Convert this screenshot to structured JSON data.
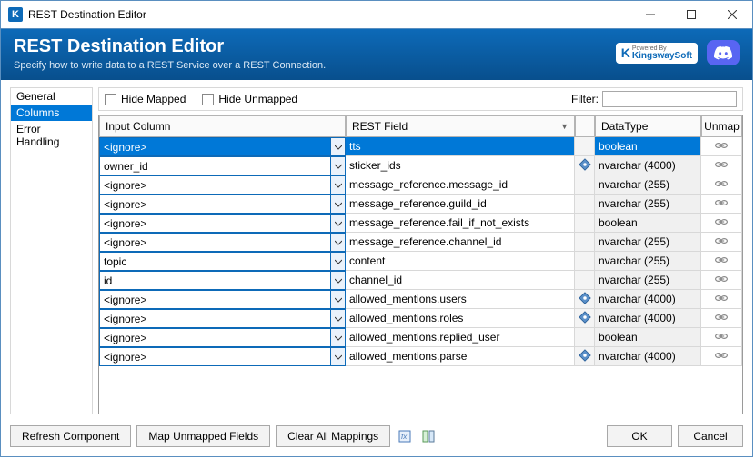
{
  "window": {
    "title": "REST Destination Editor"
  },
  "header": {
    "title": "REST Destination Editor",
    "subtitle": "Specify how to write data to a REST Service over a REST Connection.",
    "powered_prefix": "Powered By",
    "brand": "KingswaySoft"
  },
  "nav": {
    "items": [
      {
        "label": "General",
        "selected": false
      },
      {
        "label": "Columns",
        "selected": true
      },
      {
        "label": "Error Handling",
        "selected": false
      }
    ]
  },
  "toolbar": {
    "hide_mapped": "Hide Mapped",
    "hide_unmapped": "Hide Unmapped",
    "filter_label": "Filter:",
    "filter_value": ""
  },
  "grid": {
    "headers": {
      "input": "Input Column",
      "rest": "REST Field",
      "data": "DataType",
      "unmap": "Unmap"
    },
    "rows": [
      {
        "input": "<ignore>",
        "rest": "tts",
        "data": "boolean",
        "key": false,
        "selected": true
      },
      {
        "input": "owner_id",
        "rest": "sticker_ids",
        "data": "nvarchar (4000)",
        "key": true,
        "selected": false
      },
      {
        "input": "<ignore>",
        "rest": "message_reference.message_id",
        "data": "nvarchar (255)",
        "key": false,
        "selected": false
      },
      {
        "input": "<ignore>",
        "rest": "message_reference.guild_id",
        "data": "nvarchar (255)",
        "key": false,
        "selected": false
      },
      {
        "input": "<ignore>",
        "rest": "message_reference.fail_if_not_exists",
        "data": "boolean",
        "key": false,
        "selected": false
      },
      {
        "input": "<ignore>",
        "rest": "message_reference.channel_id",
        "data": "nvarchar (255)",
        "key": false,
        "selected": false
      },
      {
        "input": "topic",
        "rest": "content",
        "data": "nvarchar (255)",
        "key": false,
        "selected": false
      },
      {
        "input": "id",
        "rest": "channel_id",
        "data": "nvarchar (255)",
        "key": false,
        "selected": false
      },
      {
        "input": "<ignore>",
        "rest": "allowed_mentions.users",
        "data": "nvarchar (4000)",
        "key": true,
        "selected": false
      },
      {
        "input": "<ignore>",
        "rest": "allowed_mentions.roles",
        "data": "nvarchar (4000)",
        "key": true,
        "selected": false
      },
      {
        "input": "<ignore>",
        "rest": "allowed_mentions.replied_user",
        "data": "boolean",
        "key": false,
        "selected": false
      },
      {
        "input": "<ignore>",
        "rest": "allowed_mentions.parse",
        "data": "nvarchar (4000)",
        "key": true,
        "selected": false
      }
    ]
  },
  "footer": {
    "refresh": "Refresh Component",
    "map_unmapped": "Map Unmapped Fields",
    "clear_all": "Clear All Mappings",
    "ok": "OK",
    "cancel": "Cancel"
  }
}
